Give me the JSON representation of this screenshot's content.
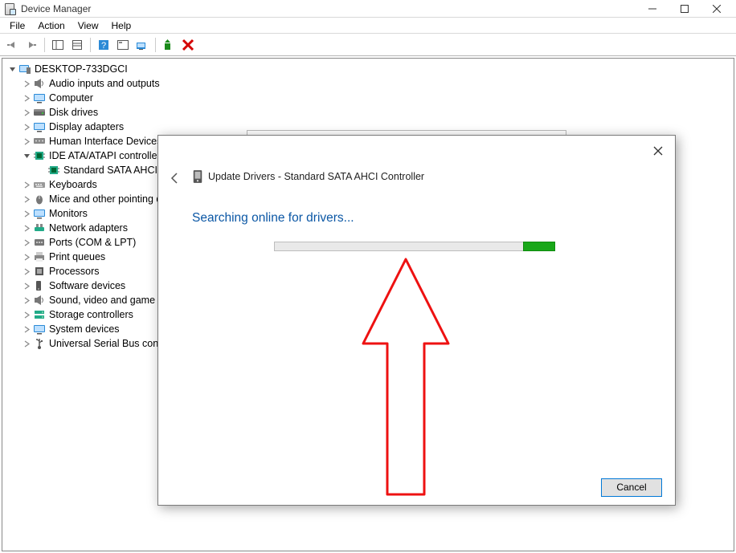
{
  "window": {
    "title": "Device Manager"
  },
  "menu": {
    "file": "File",
    "action": "Action",
    "view": "View",
    "help": "Help"
  },
  "tree": {
    "root": "DESKTOP-733DGCI",
    "items": [
      {
        "label": "Audio inputs and outputs",
        "expanded": false,
        "icon": "speaker"
      },
      {
        "label": "Computer",
        "expanded": false,
        "icon": "monitor"
      },
      {
        "label": "Disk drives",
        "expanded": false,
        "icon": "disk"
      },
      {
        "label": "Display adapters",
        "expanded": false,
        "icon": "monitor"
      },
      {
        "label": "Human Interface Devices",
        "expanded": false,
        "icon": "hid"
      },
      {
        "label": "IDE ATA/ATAPI controllers",
        "expanded": true,
        "icon": "chip",
        "children": [
          {
            "label": "Standard SATA AHCI Co"
          }
        ]
      },
      {
        "label": "Keyboards",
        "expanded": false,
        "icon": "keyboard"
      },
      {
        "label": "Mice and other pointing de",
        "expanded": false,
        "icon": "mouse"
      },
      {
        "label": "Monitors",
        "expanded": false,
        "icon": "monitor"
      },
      {
        "label": "Network adapters",
        "expanded": false,
        "icon": "net"
      },
      {
        "label": "Ports (COM & LPT)",
        "expanded": false,
        "icon": "port"
      },
      {
        "label": "Print queues",
        "expanded": false,
        "icon": "printer"
      },
      {
        "label": "Processors",
        "expanded": false,
        "icon": "cpu"
      },
      {
        "label": "Software devices",
        "expanded": false,
        "icon": "soft"
      },
      {
        "label": "Sound, video and game co",
        "expanded": false,
        "icon": "speaker"
      },
      {
        "label": "Storage controllers",
        "expanded": false,
        "icon": "storage"
      },
      {
        "label": "System devices",
        "expanded": false,
        "icon": "monitor"
      },
      {
        "label": "Universal Serial Bus contro",
        "expanded": false,
        "icon": "usb"
      }
    ]
  },
  "dialog": {
    "title": "Update Drivers - Standard SATA AHCI Controller",
    "heading": "Searching online for drivers...",
    "cancel": "Cancel"
  }
}
